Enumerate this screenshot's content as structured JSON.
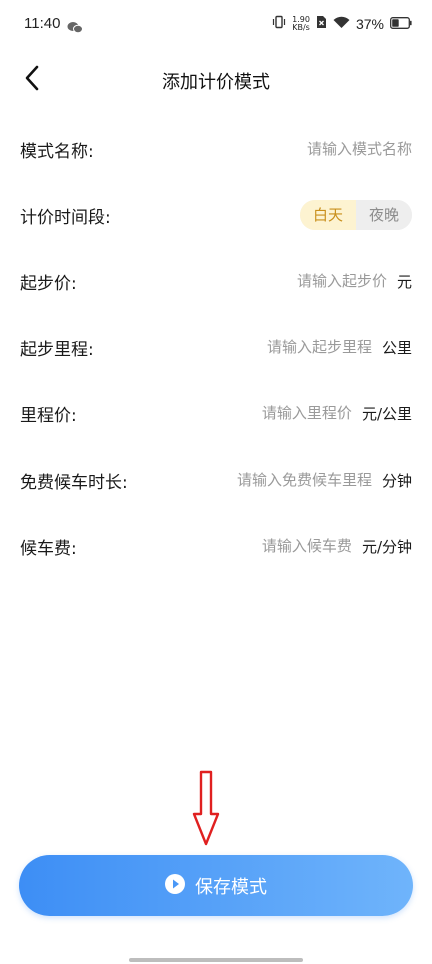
{
  "status_bar": {
    "time": "11:40",
    "net_speed_value": "1.90",
    "net_speed_unit": "KB/s",
    "battery_percent": "37%"
  },
  "header": {
    "title": "添加计价模式"
  },
  "form": {
    "mode_name": {
      "label": "模式名称:",
      "placeholder": "请输入模式名称"
    },
    "pricing_period": {
      "label": "计价时间段:",
      "options": [
        "白天",
        "夜晚"
      ],
      "selected": "白天"
    },
    "starting_price": {
      "label": "起步价:",
      "placeholder": "请输入起步价",
      "unit": "元"
    },
    "starting_distance": {
      "label": "起步里程:",
      "placeholder": "请输入起步里程",
      "unit": "公里"
    },
    "distance_price": {
      "label": "里程价:",
      "placeholder": "请输入里程价",
      "unit": "元/公里"
    },
    "free_wait_duration": {
      "label": "免费候车时长:",
      "placeholder": "请输入免费候车里程",
      "unit": "分钟"
    },
    "wait_fee": {
      "label": "候车费:",
      "placeholder": "请输入候车费",
      "unit": "元/分钟"
    }
  },
  "save_button": {
    "label": "保存模式"
  },
  "colors": {
    "accent_blue": "#3d8ef5",
    "accent_blue_light": "#6fb4fb",
    "selected_segment_bg": "#fdf3d1",
    "selected_segment_text": "#c98f1c",
    "annotation_red": "#e02020"
  }
}
